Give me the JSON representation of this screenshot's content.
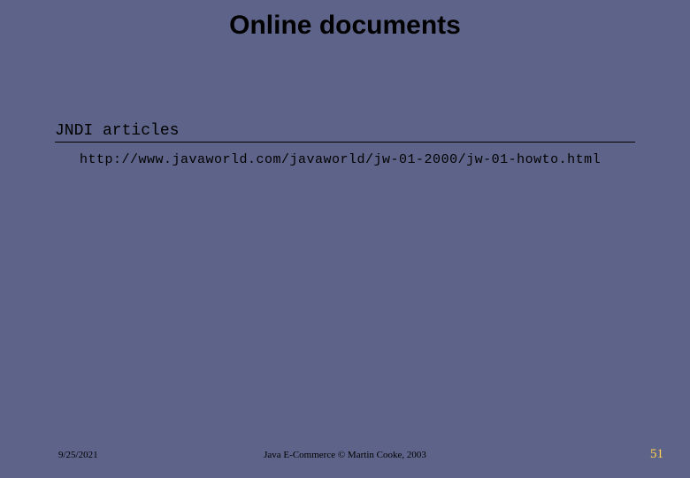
{
  "title": "Online documents",
  "section": {
    "heading": "JNDI articles",
    "link": "http://www.javaworld.com/javaworld/jw-01-2000/jw-01-howto.html"
  },
  "footer": {
    "date": "9/25/2021",
    "credit": "Java E-Commerce © Martin Cooke, 2003",
    "page": "51"
  }
}
